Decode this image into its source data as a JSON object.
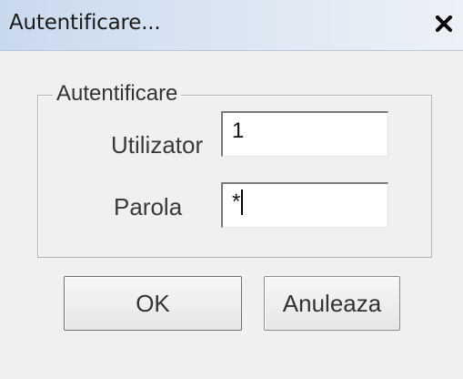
{
  "window": {
    "title": "Autentificare...",
    "close_icon": "close-icon"
  },
  "group": {
    "legend": "Autentificare"
  },
  "fields": {
    "user_label": "Utilizator",
    "user_value": "1",
    "password_label": "Parola",
    "password_value": "*"
  },
  "buttons": {
    "ok_label": "OK",
    "cancel_label": "Anuleaza"
  },
  "colors": {
    "titlebar_start": "#c9d9ed",
    "titlebar_end": "#edf1f6",
    "dialog_bg": "#f0f0f0"
  }
}
